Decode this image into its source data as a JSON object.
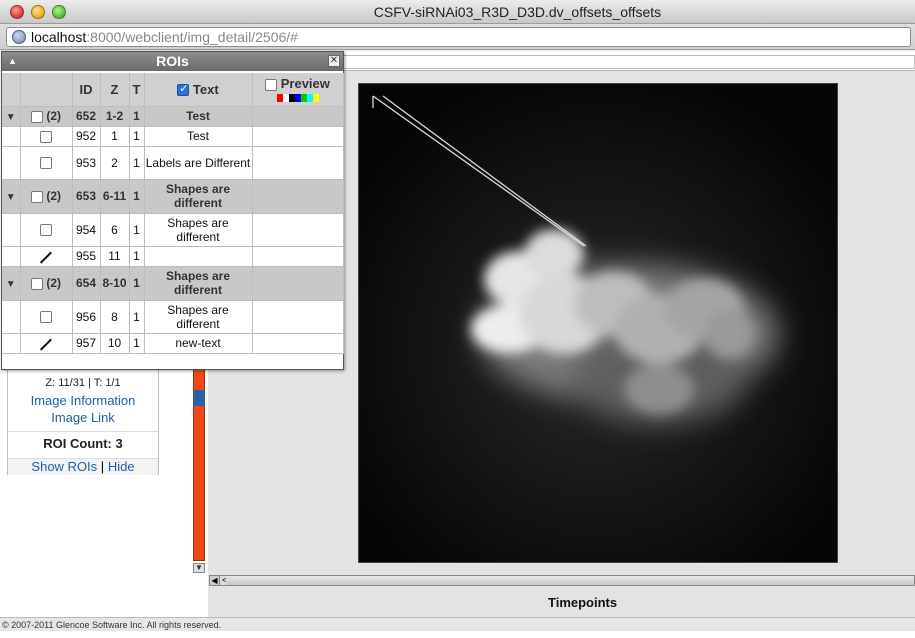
{
  "window": {
    "title": "CSFV-siRNAi03_R3D_D3D.dv_offsets_offsets"
  },
  "url": {
    "host": "localhost",
    "rest": ":8000/webclient/img_detail/2506/#"
  },
  "roi_panel": {
    "title": "ROIs",
    "collapse": "▲",
    "close": "✕",
    "columns": {
      "id": "ID",
      "z": "Z",
      "t": "T",
      "text": "Text",
      "preview": "Preview"
    },
    "swatch_colors": [
      "#ff0000",
      "#ffffff",
      "#000000",
      "#0000ff",
      "#00cc00",
      "#00ffff",
      "#ffff00"
    ],
    "rows": [
      {
        "kind": "group",
        "size": "g1",
        "count": "(2)",
        "id": "652",
        "z": "1-2",
        "t": "1",
        "text": "Test"
      },
      {
        "kind": "shape",
        "size": "s1",
        "icon": "checkbox",
        "id": "952",
        "z": "1",
        "t": "1",
        "text": "Test"
      },
      {
        "kind": "shape",
        "size": "s2",
        "icon": "checkbox",
        "id": "953",
        "z": "2",
        "t": "1",
        "text": "Labels are Different"
      },
      {
        "kind": "group",
        "size": "g2",
        "count": "(2)",
        "id": "653",
        "z": "6-11",
        "t": "1",
        "text": "Shapes are different"
      },
      {
        "kind": "shape",
        "size": "s2",
        "icon": "checkbox",
        "id": "954",
        "z": "6",
        "t": "1",
        "text": "Shapes are different"
      },
      {
        "kind": "shape",
        "size": "s1",
        "icon": "line",
        "id": "955",
        "z": "11",
        "t": "1",
        "text": ""
      },
      {
        "kind": "group",
        "size": "g2",
        "count": "(2)",
        "id": "654",
        "z": "8-10",
        "t": "1",
        "text": "Shapes are different"
      },
      {
        "kind": "shape",
        "size": "s2",
        "icon": "checkbox",
        "id": "956",
        "z": "8",
        "t": "1",
        "text": "Shapes are different"
      },
      {
        "kind": "shape",
        "size": "s1",
        "icon": "line",
        "id": "957",
        "z": "10",
        "t": "1",
        "text": "new-text"
      }
    ]
  },
  "info": {
    "zt": "Z: 11/31 | T: 1/1",
    "image_information": "Image Information",
    "image_link": "Image Link",
    "roi_count": "ROI Count: 3",
    "show_rois": "Show ROIs",
    "separator": "|",
    "hide": "Hide"
  },
  "viewer": {
    "timepoints_label": "Timepoints",
    "t_prev": "◀",
    "t_tick": "<",
    "z_up": "▲",
    "z_down": "▼"
  },
  "footer": {
    "copyright": "© 2007-2011 Glencoe Software Inc. All rights reserved."
  },
  "colors": {
    "z_slider": "#ee4a18",
    "z_thumb": "#2f5fa6",
    "link": "#2360a8",
    "panel_header": "#7a7a7a"
  }
}
